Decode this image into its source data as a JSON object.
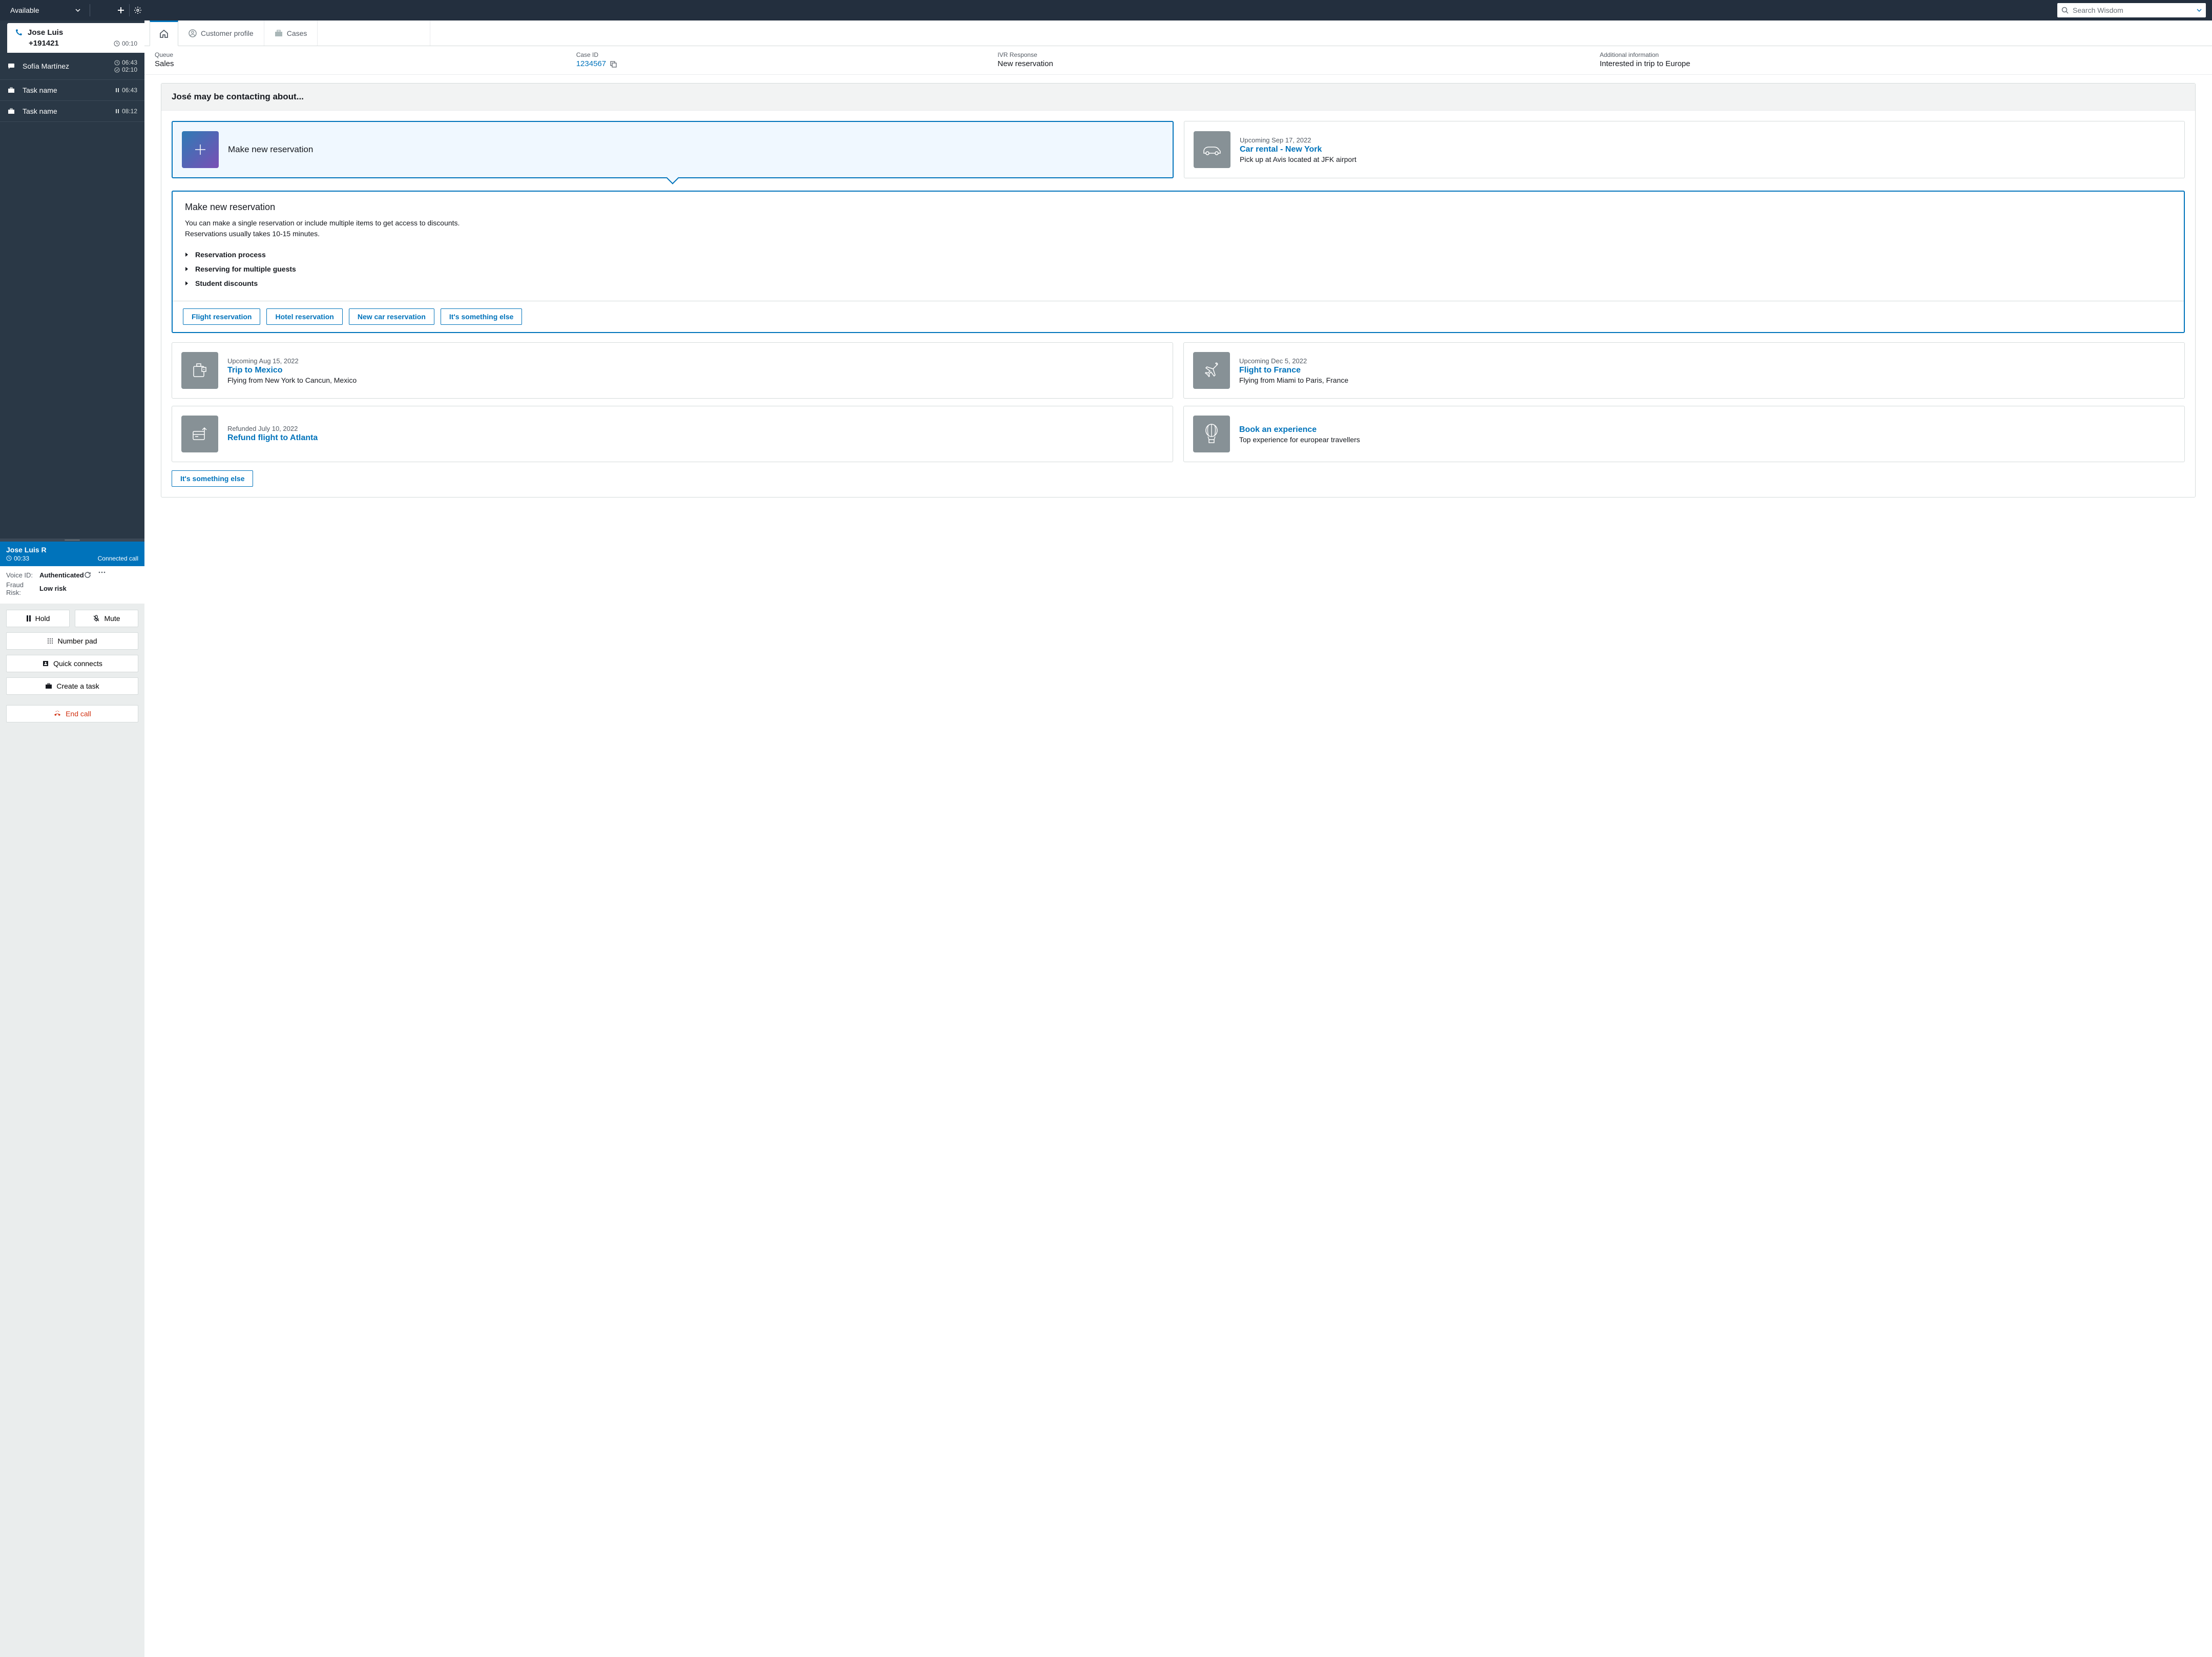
{
  "topbar": {
    "status": "Available",
    "search_placeholder": "Search Wisdom"
  },
  "active_contact": {
    "name": "Jose Luis",
    "phone": "+191421",
    "time": "00:10"
  },
  "contacts": [
    {
      "name": "Sofía Martínez",
      "t1": "06:43",
      "t2": "02:10",
      "type": "chat"
    },
    {
      "name": "Task name",
      "t1": "06:43",
      "type": "task",
      "paused": true
    },
    {
      "name": "Task name",
      "t1": "08:12",
      "type": "task",
      "paused": true
    }
  ],
  "call": {
    "name": "Jose Luis R",
    "timer": "00:33",
    "status": "Connected call",
    "voice_id_label": "Voice ID:",
    "voice_id_value": "Authenticated",
    "fraud_label": "Fraud Risk:",
    "fraud_value": "Low risk"
  },
  "controls": {
    "hold": "Hold",
    "mute": "Mute",
    "numpad": "Number pad",
    "quick": "Quick connects",
    "task": "Create a task",
    "end": "End call"
  },
  "tabs": {
    "profile": "Customer profile",
    "cases": "Cases"
  },
  "info": {
    "queue_label": "Queue",
    "queue_value": "Sales",
    "case_label": "Case ID",
    "case_value": "1234567",
    "ivr_label": "IVR Response",
    "ivr_value": "New reservation",
    "addl_label": "Additional information",
    "addl_value": "Interested in trip to Europe"
  },
  "suggestions": {
    "header": "José may be contacting about...",
    "new_res": "Make new reservation",
    "car": {
      "meta": "Upcoming Sep 17, 2022",
      "title": "Car rental - New York",
      "desc": "Pick up at Avis located at JFK airport"
    },
    "detail": {
      "title": "Make new reservation",
      "desc1": "You can make a single reservation or include multiple items to get access to discounts.",
      "desc2": "Reservations usually takes 10-15 minutes.",
      "items": [
        "Reservation process",
        "Reserving for multiple guests",
        "Student discounts"
      ],
      "actions": [
        "Flight reservation",
        "Hotel reservation",
        "New car reservation",
        "It's something else"
      ]
    },
    "mexico": {
      "meta": "Upcoming Aug 15, 2022",
      "title": "Trip to Mexico",
      "desc": "Flying from New York to Cancun, Mexico"
    },
    "france": {
      "meta": "Upcoming Dec 5, 2022",
      "title": "Flight to France",
      "desc": "Flying from Miami to Paris, France"
    },
    "refund": {
      "meta": "Refunded July 10, 2022",
      "title": "Refund flight to Atlanta"
    },
    "book": {
      "title": "Book an experience",
      "desc": "Top experience for europear travellers"
    },
    "else": "It's something else"
  }
}
